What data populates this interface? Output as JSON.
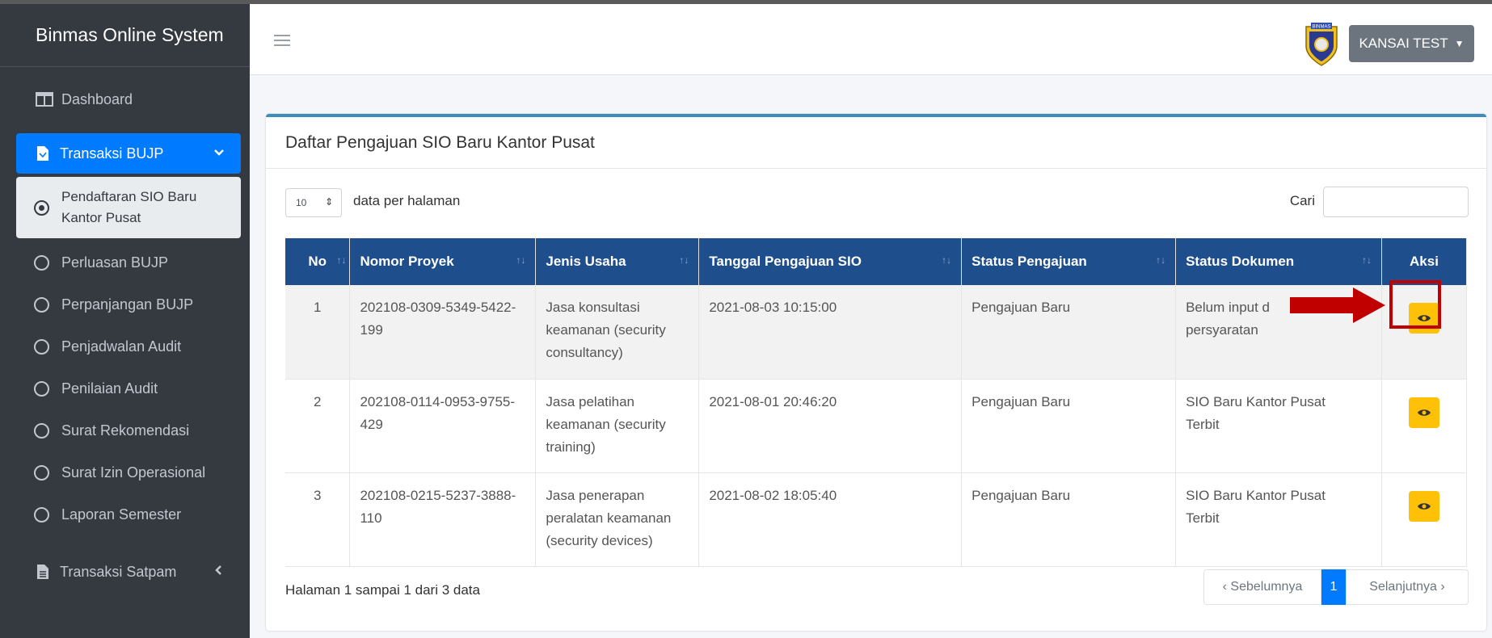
{
  "app": {
    "brand": "Binmas Online System"
  },
  "sidebar": {
    "dashboard": "Dashboard",
    "transaksi_bujp": "Transaksi BUJP",
    "active_sub": [
      "Pendaftaran SIO Baru",
      "Kantor Pusat"
    ],
    "items": [
      "Perluasan BUJP",
      "Perpanjangan BUJP",
      "Penjadwalan Audit",
      "Penilaian Audit",
      "Surat Rekomendasi",
      "Surat Izin Operasional",
      "Laporan Semester"
    ],
    "transaksi_satpam": "Transaksi Satpam"
  },
  "topbar": {
    "logo_text": "BINMAS",
    "user": "KANSAI TEST"
  },
  "card": {
    "title": "Daftar Pengajuan SIO Baru Kantor Pusat",
    "per_page_value": "10",
    "per_page_label": "data per halaman",
    "search_label": "Cari",
    "search_value": ""
  },
  "table": {
    "headers": [
      "No",
      "Nomor Proyek",
      "Jenis Usaha",
      "Tanggal Pengajuan SIO",
      "Status Pengajuan",
      "Status Dokumen",
      "Aksi"
    ],
    "rows": [
      {
        "no": "1",
        "proyek": [
          "202108-0309-5349-5422-",
          "199"
        ],
        "jenis": [
          "Jasa konsultasi",
          "keamanan (security",
          "consultancy)"
        ],
        "tanggal": "2021-08-03 10:15:00",
        "status_pengajuan": "Pengajuan Baru",
        "status_dokumen": [
          "Belum input d",
          "persyaratan"
        ]
      },
      {
        "no": "2",
        "proyek": [
          "202108-0114-0953-9755-",
          "429"
        ],
        "jenis": [
          "Jasa pelatihan",
          "keamanan (security",
          "training)"
        ],
        "tanggal": "2021-08-01 20:46:20",
        "status_pengajuan": "Pengajuan Baru",
        "status_dokumen": [
          "SIO Baru Kantor Pusat",
          "Terbit"
        ]
      },
      {
        "no": "3",
        "proyek": [
          "202108-0215-5237-3888-",
          "110"
        ],
        "jenis": [
          "Jasa penerapan",
          "peralatan keamanan",
          "(security devices)"
        ],
        "tanggal": "2021-08-02 18:05:40",
        "status_pengajuan": "Pengajuan Baru",
        "status_dokumen": [
          "SIO Baru Kantor Pusat",
          "Terbit"
        ]
      }
    ]
  },
  "footer": {
    "info": "Halaman 1 sampai 1 dari 3 data",
    "prev": "Sebelumnya",
    "current": "1",
    "next": "Selanjutnya"
  },
  "colors": {
    "sidebar_bg": "#343a40",
    "active_nav": "#007bff",
    "table_header": "#1f4e8c",
    "eye_button": "#ffc107",
    "annotation": "#c00000"
  }
}
